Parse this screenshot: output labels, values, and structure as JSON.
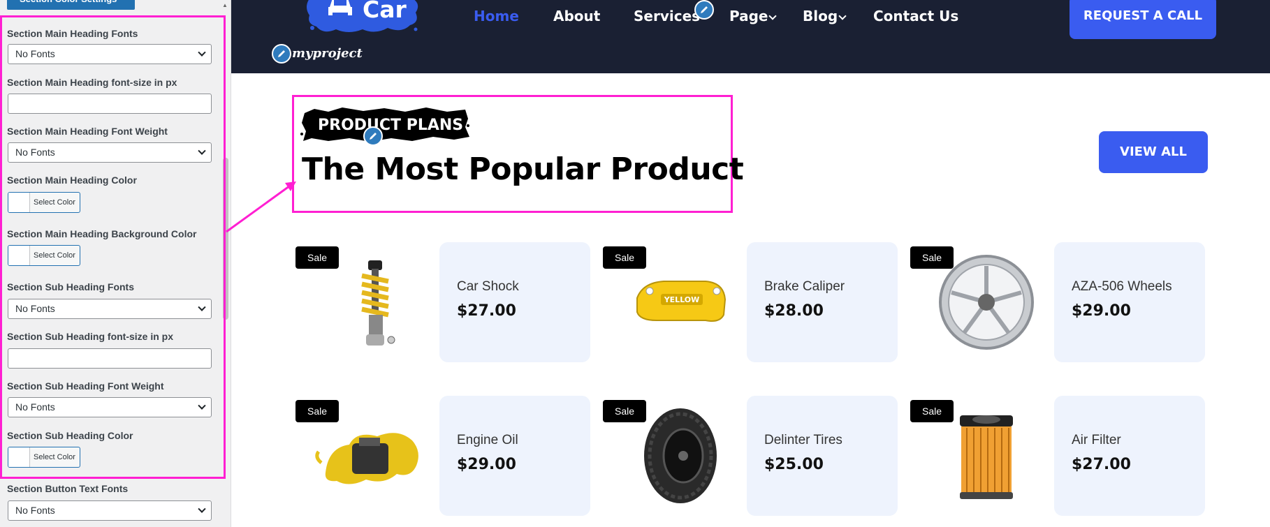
{
  "sidebar": {
    "section_button": "Section Color Settings",
    "fields": [
      {
        "label": "Section Main Heading Fonts",
        "type": "select",
        "value": "No Fonts"
      },
      {
        "label": "Section Main Heading font-size in px",
        "type": "text",
        "value": ""
      },
      {
        "label": "Section Main Heading Font Weight",
        "type": "select",
        "value": "No Fonts"
      },
      {
        "label": "Section Main Heading Color",
        "type": "color",
        "value": "Select Color"
      },
      {
        "label": "Section Main Heading Background Color",
        "type": "color",
        "value": "Select Color"
      },
      {
        "label": "Section Sub Heading Fonts",
        "type": "select",
        "value": "No Fonts"
      },
      {
        "label": "Section Sub Heading font-size in px",
        "type": "text",
        "value": ""
      },
      {
        "label": "Section Sub Heading Font Weight",
        "type": "select",
        "value": "No Fonts"
      },
      {
        "label": "Section Sub Heading Color",
        "type": "color",
        "value": "Select Color"
      },
      {
        "label": "Section Button Text Fonts",
        "type": "select",
        "value": "No Fonts"
      }
    ]
  },
  "header": {
    "logo_text": "Car",
    "site_tag": "myproject",
    "nav": [
      {
        "label": "Home",
        "active": true,
        "dropdown": false
      },
      {
        "label": "About",
        "active": false,
        "dropdown": false
      },
      {
        "label": "Services",
        "active": false,
        "dropdown": false
      },
      {
        "label": "Page",
        "active": false,
        "dropdown": true
      },
      {
        "label": "Blog",
        "active": false,
        "dropdown": true
      },
      {
        "label": "Contact Us",
        "active": false,
        "dropdown": false
      }
    ],
    "cta": "REQUEST A CALL"
  },
  "section": {
    "tag": "PRODUCT PLANS",
    "heading": "The Most Popular Product",
    "view_all": "VIEW ALL"
  },
  "products": [
    {
      "name": "Car Shock",
      "price": "$27.00",
      "badge": "Sale",
      "icon": "shock-absorber-icon"
    },
    {
      "name": "Brake Caliper",
      "price": "$28.00",
      "badge": "Sale",
      "icon": "brake-caliper-icon"
    },
    {
      "name": "AZA-506 Wheels",
      "price": "$29.00",
      "badge": "Sale",
      "icon": "wheel-icon"
    },
    {
      "name": "Engine Oil",
      "price": "$29.00",
      "badge": "Sale",
      "icon": "engine-oil-icon"
    },
    {
      "name": "Delinter Tires",
      "price": "$25.00",
      "badge": "Sale",
      "icon": "tire-icon"
    },
    {
      "name": "Air Filter",
      "price": "$27.00",
      "badge": "Sale",
      "icon": "air-filter-icon"
    }
  ],
  "colors": {
    "accent": "#3a5cf0",
    "header_bg": "#1a2033",
    "highlight": "#ff1fd2",
    "card_bg": "#eef3fd",
    "sidebar_bg": "#f0f0f1"
  }
}
